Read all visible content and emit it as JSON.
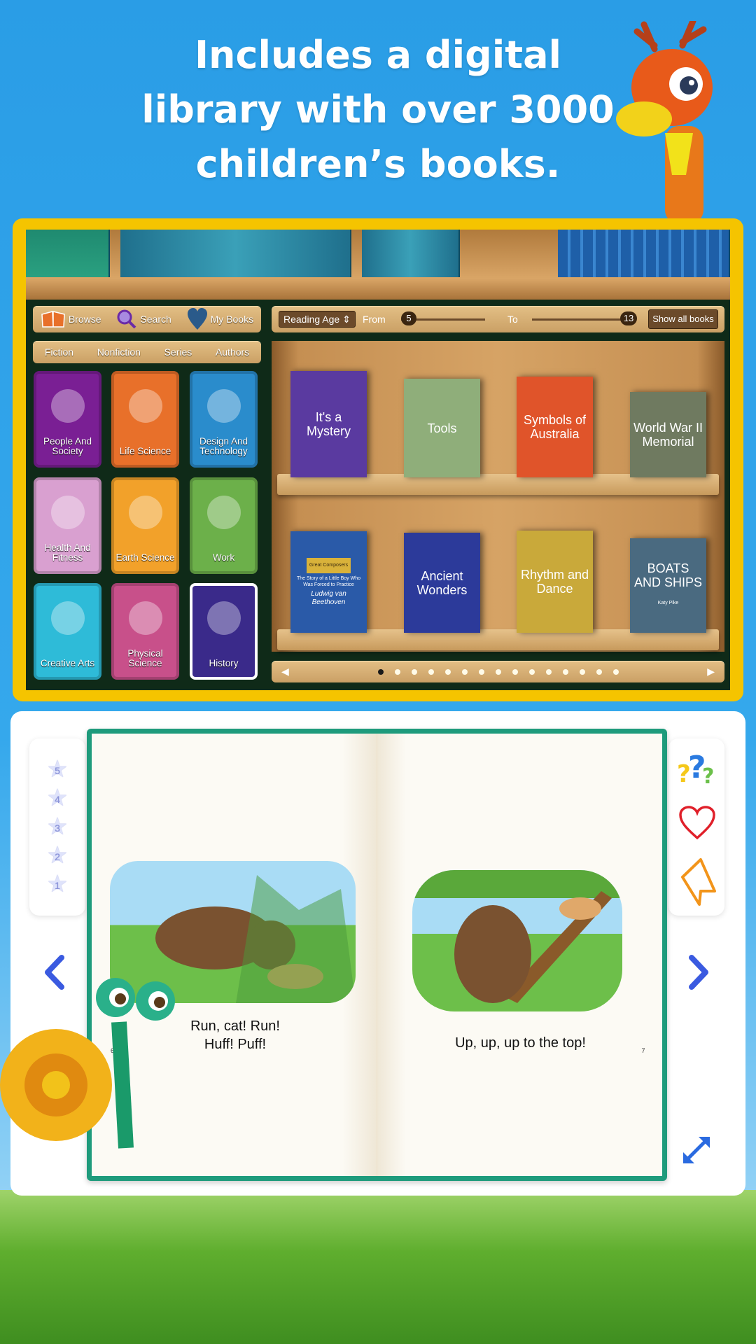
{
  "headline": {
    "line1": "Includes a digital",
    "line2": "library with over 3000",
    "line3": "children’s books."
  },
  "library": {
    "nav": [
      {
        "label": "Browse",
        "icon": "open-book-icon"
      },
      {
        "label": "Search",
        "icon": "magnifier-icon"
      },
      {
        "label": "My Books",
        "icon": "heart-icon"
      }
    ],
    "filters": [
      "Fiction",
      "Nonfiction",
      "Series",
      "Authors"
    ],
    "categories": [
      {
        "label": "People And Society",
        "color": "#7a1f94"
      },
      {
        "label": "Life Science",
        "color": "#e8702a"
      },
      {
        "label": "Design And Technology",
        "color": "#2a8ccc"
      },
      {
        "label": "Health And Fitness",
        "color": "#d9a0d0"
      },
      {
        "label": "Earth Science",
        "color": "#f2a12a"
      },
      {
        "label": "Work",
        "color": "#6cb04a"
      },
      {
        "label": "Creative Arts",
        "color": "#2ebbd8"
      },
      {
        "label": "Physical Science",
        "color": "#c8508a"
      },
      {
        "label": "History",
        "color": "#3a2a8a",
        "selected": true
      }
    ],
    "toolbar": {
      "reading_age": "Reading Age",
      "from_label": "From",
      "from_value": "5",
      "to_label": "To",
      "to_value": "13",
      "show_all": "Show all books"
    },
    "books": [
      {
        "title": "It's a Mystery",
        "color": "#5a3aa0"
      },
      {
        "title": "Tools",
        "color": "#8fae7a"
      },
      {
        "title": "Symbols of Australia",
        "color": "#e0542a"
      },
      {
        "title": "World War II Memorial",
        "color": "#6f7a60"
      },
      {
        "title": "Ludwig van Beethoven",
        "subtitle": "The Story of a Little Boy Who Was Forced to Practice",
        "series": "Great Composers",
        "color": "#2a5aa8"
      },
      {
        "title": "Ancient Wonders",
        "color": "#2c3a9a"
      },
      {
        "title": "Rhythm and Dance",
        "color": "#c9a93a"
      },
      {
        "title": "BOATS AND SHIPS",
        "author": "Katy Pike",
        "color": "#4a6a80"
      }
    ],
    "pager": {
      "pages": 15,
      "current": 1
    }
  },
  "reader": {
    "rating_stars": [
      "5",
      "4",
      "3",
      "2",
      "1"
    ],
    "left_page": {
      "caption_line1": "Run, cat! Run!",
      "caption_line2": "Huff! Puff!",
      "page_number": "6"
    },
    "right_page": {
      "caption": "Up, up, up to the top!",
      "page_number": "7"
    },
    "tools": [
      "question-icon",
      "heart-icon",
      "bookmark-icon"
    ],
    "accent": "#3a5ae0",
    "book_border": "#1e9b7c"
  }
}
